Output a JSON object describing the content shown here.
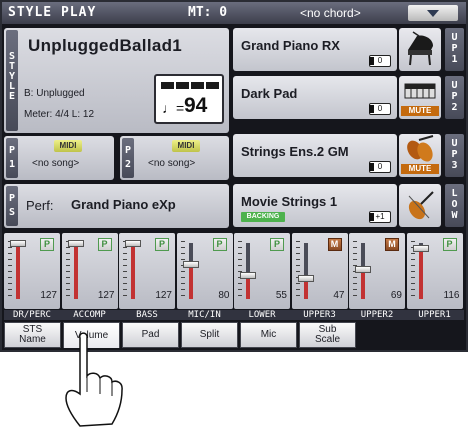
{
  "titlebar": {
    "title": "STYLE PLAY",
    "mt": "MT: 0",
    "chord": "<no chord>"
  },
  "style": {
    "tab_letters": [
      "S",
      "T",
      "Y",
      "L",
      "E"
    ],
    "name": "UnpluggedBallad1",
    "bank": "B: Unplugged",
    "meter": "Meter: 4/4  L: 12",
    "tempo_note": "♩=",
    "tempo": "94"
  },
  "songs": [
    {
      "tab": "P",
      "num": "1",
      "badge": "MIDI",
      "value": "<no song>"
    },
    {
      "tab": "P",
      "num": "2",
      "badge": "MIDI",
      "value": "<no song>"
    }
  ],
  "perf": {
    "tab_letters": [
      "P",
      "S"
    ],
    "label": "Perf:",
    "value": "Grand Piano eXp"
  },
  "sounds": [
    {
      "name": "Grand Piano RX",
      "indicator": "0",
      "tab": [
        "U",
        "P",
        "1"
      ],
      "icon": "grand-piano-icon",
      "mute": "",
      "badge": ""
    },
    {
      "name": "Dark Pad",
      "indicator": "0",
      "tab": [
        "U",
        "P",
        "2"
      ],
      "icon": "synth-keyboard-icon",
      "mute": "MUTE",
      "badge": ""
    },
    {
      "name": "Strings Ens.2 GM",
      "indicator": "0",
      "tab": [
        "U",
        "P",
        "3"
      ],
      "icon": "strings-icon",
      "mute": "MUTE",
      "badge": ""
    },
    {
      "name": "Movie Strings 1",
      "indicator": "+1",
      "tab": [
        "L",
        "O",
        "W"
      ],
      "icon": "violin-icon",
      "mute": "",
      "badge": "BACKING"
    }
  ],
  "mixer": [
    {
      "label": "DR/PERC",
      "value": "127",
      "level": 1.0,
      "mode": "P"
    },
    {
      "label": "ACCOMP",
      "value": "127",
      "level": 1.0,
      "mode": "P"
    },
    {
      "label": "BASS",
      "value": "127",
      "level": 1.0,
      "mode": "P"
    },
    {
      "label": "MIC/IN",
      "value": "80",
      "level": 0.63,
      "mode": "P"
    },
    {
      "label": "LOWER",
      "value": "55",
      "level": 0.43,
      "mode": "P"
    },
    {
      "label": "UPPER3",
      "value": "47",
      "level": 0.37,
      "mode": "M"
    },
    {
      "label": "UPPER2",
      "value": "69",
      "level": 0.54,
      "mode": "M"
    },
    {
      "label": "UPPER1",
      "value": "116",
      "level": 0.91,
      "mode": "P"
    }
  ],
  "tabs": [
    {
      "line1": "STS",
      "line2": "Name",
      "active": false
    },
    {
      "line1": "Volume",
      "line2": "",
      "active": true
    },
    {
      "line1": "Pad",
      "line2": "",
      "active": false
    },
    {
      "line1": "Split",
      "line2": "",
      "active": false
    },
    {
      "line1": "Mic",
      "line2": "",
      "active": false
    },
    {
      "line1": "Sub",
      "line2": "Scale",
      "active": false
    }
  ],
  "colors": {
    "title_bar": "#4b4e5e",
    "midi_badge": "#d9dc6a",
    "mute_badge": "#c46a0e",
    "backing_badge": "#4db24d",
    "label_strip": "#31333f",
    "fader_fill": "#c23232"
  }
}
